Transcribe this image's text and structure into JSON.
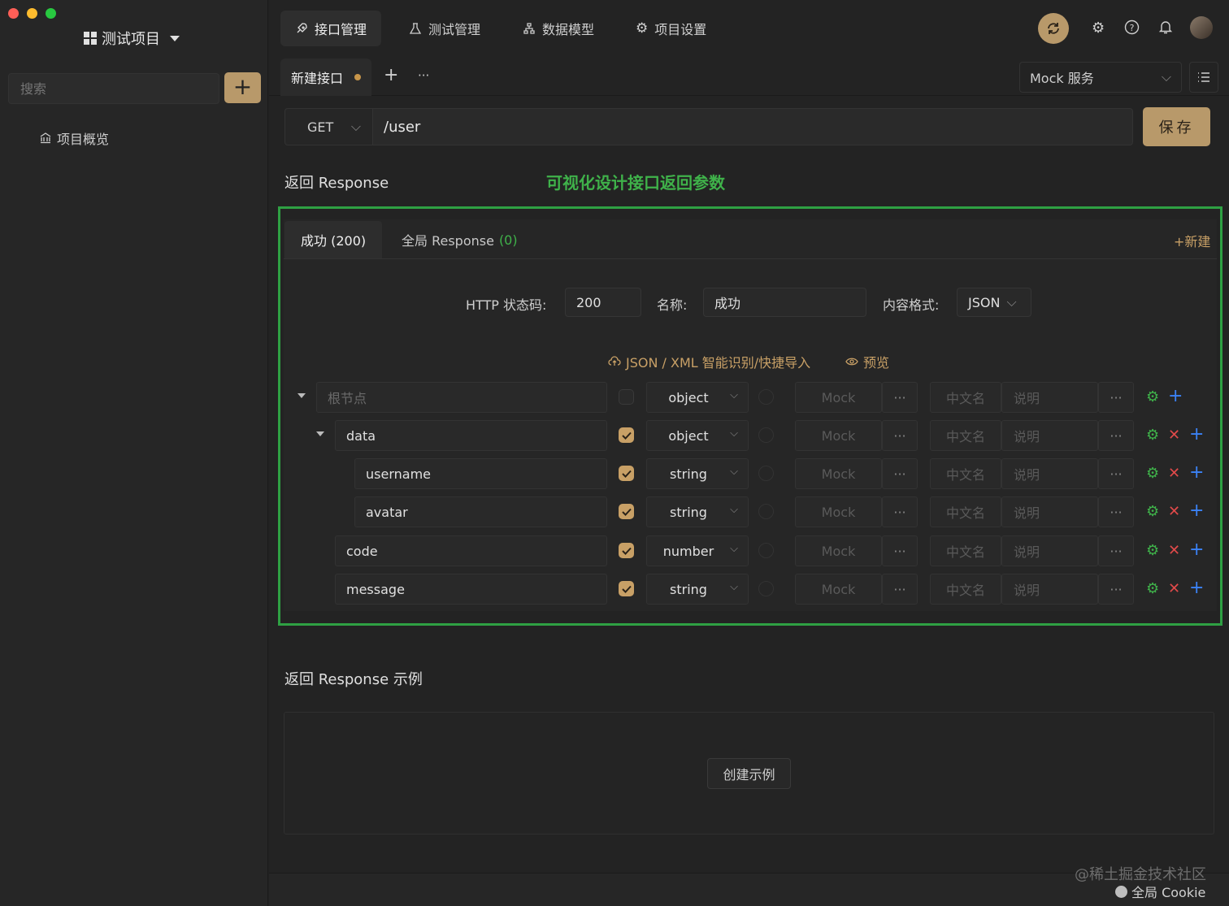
{
  "colors": {
    "accent": "#b8996a",
    "highlight_green": "#2ea043",
    "link_gold": "#c8a066",
    "close_red": "#e04a4a",
    "add_blue": "#3b82f6",
    "gear_green": "#3fb24a"
  },
  "sidebar": {
    "project_title": "测试项目",
    "search_placeholder": "搜索",
    "add_label": "+",
    "overview": "项目概览"
  },
  "nav": {
    "tabs": [
      {
        "label": "接口管理",
        "icon": "rocket-icon"
      },
      {
        "label": "测试管理",
        "icon": "flask-icon"
      },
      {
        "label": "数据模型",
        "icon": "model-icon"
      },
      {
        "label": "项目设置",
        "icon": "gear-icon"
      }
    ]
  },
  "tabbar": {
    "file_tab": "新建接口",
    "add": "+",
    "more": "···",
    "mock_service": "Mock 服务"
  },
  "request": {
    "method": "GET",
    "url": "/user",
    "save": "保存"
  },
  "response": {
    "title": "返回 Response",
    "note": "可视化设计接口返回参数",
    "tabs": [
      {
        "label": "成功 (200)"
      },
      {
        "label": "全局 Response",
        "count": "(0)"
      }
    ],
    "new_label": "+新建",
    "status_label": "HTTP 状态码:",
    "status_value": "200",
    "name_label": "名称:",
    "name_value": "成功",
    "format_label": "内容格式:",
    "format_value": "JSON",
    "import_label": "JSON / XML 智能识别/快捷导入",
    "preview_label": "预览",
    "mock_placeholder": "Mock",
    "cn_placeholder": "中文名",
    "desc_placeholder": "说明",
    "dots": "···",
    "rows": [
      {
        "name": "根节点",
        "placeholder": true,
        "required": false,
        "type": "object",
        "collapsible": true,
        "removable": false
      },
      {
        "name": "data",
        "placeholder": false,
        "required": true,
        "type": "object",
        "collapsible": true,
        "removable": true
      },
      {
        "name": "username",
        "placeholder": false,
        "required": true,
        "type": "string",
        "collapsible": false,
        "removable": true
      },
      {
        "name": "avatar",
        "placeholder": false,
        "required": true,
        "type": "string",
        "collapsible": false,
        "removable": true
      },
      {
        "name": "code",
        "placeholder": false,
        "required": true,
        "type": "number",
        "collapsible": false,
        "removable": true
      },
      {
        "name": "message",
        "placeholder": false,
        "required": true,
        "type": "string",
        "collapsible": false,
        "removable": true
      }
    ]
  },
  "example": {
    "title": "返回 Response 示例",
    "create": "创建示例"
  },
  "footer": {
    "cookie": "全局 Cookie",
    "watermark": "@稀土掘金技术社区"
  }
}
